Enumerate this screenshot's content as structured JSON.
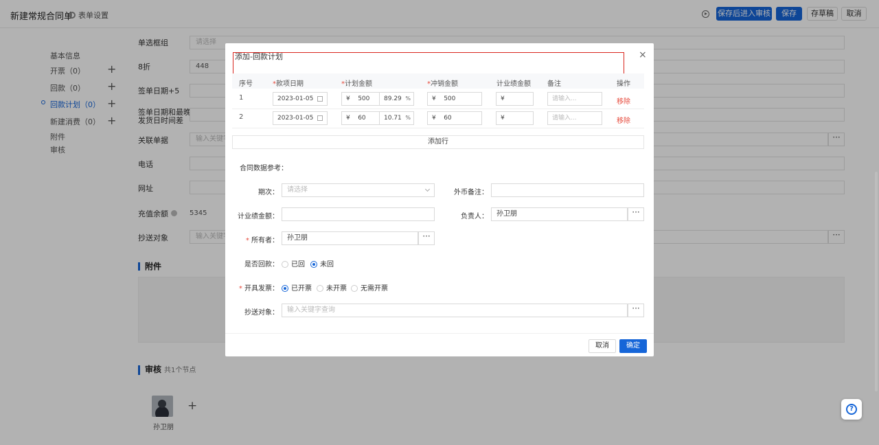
{
  "header": {
    "title": "新建常规合同单",
    "form_settings": "表单设置",
    "buttons": {
      "save_submit": "保存后进入审核",
      "save": "保存",
      "draft": "存草稿",
      "cancel": "取消"
    }
  },
  "sidenav": {
    "items": [
      {
        "label": "基本信息"
      },
      {
        "label": "开票（0）"
      },
      {
        "label": "回款（0）"
      },
      {
        "label": "回款计划（0）"
      },
      {
        "label": "新建消费（0）"
      },
      {
        "label": "附件"
      },
      {
        "label": "审核"
      }
    ]
  },
  "form": {
    "radio_frame_label": "单选框组",
    "radio_frame_placeholder": "请选择",
    "discount_label": "8折",
    "discount_value": "448",
    "sign_date_label": "签单日期+5",
    "sign_ship_label_1": "签单日期和最晚",
    "sign_ship_label_2": "发货日时间差",
    "related_doc_label": "关联单据",
    "related_doc_placeholder": "输入关键字",
    "phone_label": "电话",
    "website_label": "网址",
    "balance_label": "充值余额",
    "balance_value": "5345",
    "cc_label": "抄送对象",
    "cc_placeholder": "输入关键字"
  },
  "attachments": {
    "title": "附件"
  },
  "review": {
    "title": "审核",
    "node_count": "共1个节点",
    "reviewer": "孙卫朋"
  },
  "modal": {
    "title": "添加-回款计划",
    "close": "×",
    "columns": {
      "index": "序号",
      "date": "款项日期",
      "plan_amount": "计划金额",
      "offset_amount": "冲销金额",
      "perf_amount": "计业绩金额",
      "remark": "备注",
      "action": "操作"
    },
    "rows": [
      {
        "index": "1",
        "date": "2023-01-05",
        "currency": "¥",
        "plan": "500",
        "percent": "89.29",
        "offset": "500",
        "perf": "",
        "remark_placeholder": "请输入...",
        "remove": "移除"
      },
      {
        "index": "2",
        "date": "2023-01-05",
        "currency": "¥",
        "plan": "60",
        "percent": "10.71",
        "offset": "60",
        "perf": "",
        "remark_placeholder": "请输入...",
        "remove": "移除"
      }
    ],
    "percent_sign": "%",
    "add_row": "添加行",
    "ref_label": "合同数据参考：",
    "period_label": "期次：",
    "period_placeholder": "请选择",
    "fx_remark_label": "外币备注：",
    "perf_label": "计业绩金额：",
    "owner_person_label": "负责人：",
    "owner_person_value": "孙卫朋",
    "owner_label": "所有者：",
    "owner_value": "孙卫朋",
    "returned_label": "是否回款：",
    "returned_options": [
      "已回",
      "未回"
    ],
    "returned_selected": "未回",
    "invoice_label": "开具发票：",
    "invoice_options": [
      "已开票",
      "未开票",
      "无需开票"
    ],
    "invoice_selected": "已开票",
    "cc_label": "抄送对象：",
    "cc_placeholder": "输入关键字查询",
    "cancel": "取消",
    "confirm": "确定"
  },
  "colors": {
    "primary": "#1565d8",
    "danger": "#e64a3c",
    "highlight_box": "#d9251d"
  }
}
